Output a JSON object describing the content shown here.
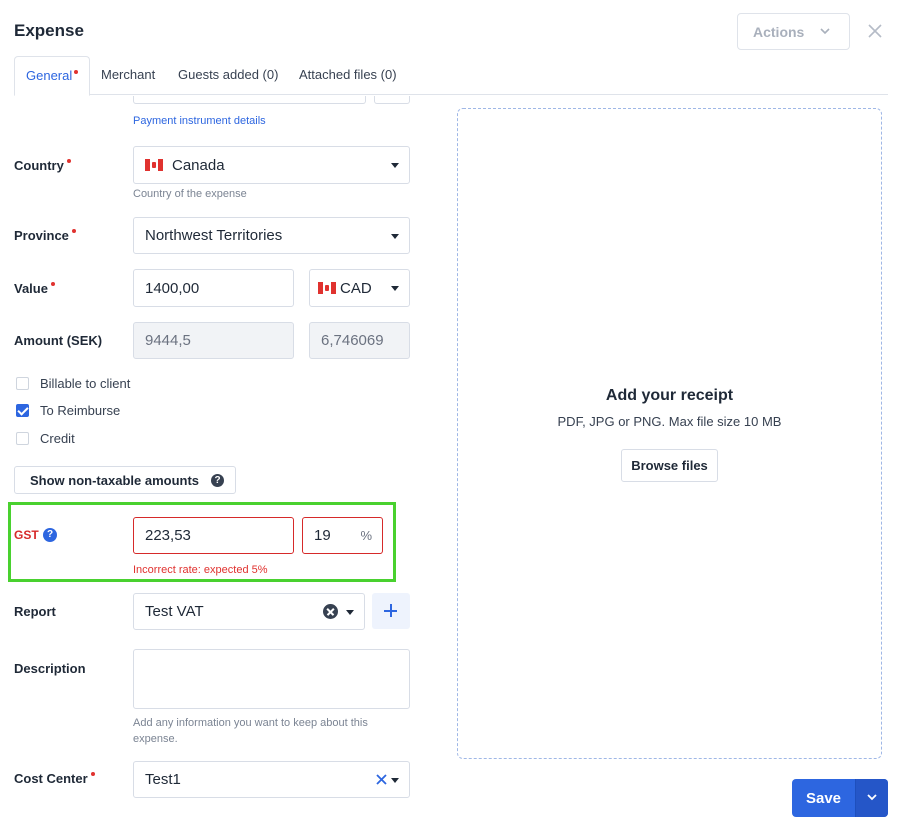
{
  "header": {
    "title": "Expense",
    "actions_label": "Actions"
  },
  "tabs": [
    {
      "label": "General",
      "active": true,
      "required": true
    },
    {
      "label": "Merchant"
    },
    {
      "label": "Guests added (0)"
    },
    {
      "label": "Attached files (0)"
    }
  ],
  "payment": {
    "link": "Payment instrument details"
  },
  "form": {
    "country": {
      "label": "Country",
      "value": "Canada",
      "flag": "canada-flag",
      "helper": "Country of the expense"
    },
    "province": {
      "label": "Province",
      "value": "Northwest Territories"
    },
    "value": {
      "label": "Value",
      "amount": "1400,00",
      "currency": "CAD"
    },
    "amount_sek": {
      "label": "Amount (SEK)",
      "amount": "9444,5",
      "rate": "6,746069"
    },
    "checkboxes": [
      {
        "label": "Billable to client",
        "checked": false
      },
      {
        "label": "To Reimburse",
        "checked": true
      },
      {
        "label": "Credit",
        "checked": false
      }
    ],
    "non_taxable_button": "Show non-taxable amounts",
    "gst": {
      "label": "GST",
      "amount": "223,53",
      "rate": "19",
      "unit": "%",
      "error": "Incorrect rate: expected 5%"
    },
    "report": {
      "label": "Report",
      "value": "Test VAT"
    },
    "description": {
      "label": "Description",
      "value": "",
      "helper": "Add any information you want to keep about this expense."
    },
    "cost_center": {
      "label": "Cost Center",
      "value": "Test1"
    }
  },
  "receipt": {
    "title": "Add your receipt",
    "subtitle": "PDF, JPG or PNG. Max file size 10 MB",
    "browse_label": "Browse files"
  },
  "footer": {
    "save_label": "Save"
  },
  "colors": {
    "accent": "#2d66e0",
    "error": "#d62a2a",
    "highlight": "#49d12f"
  }
}
